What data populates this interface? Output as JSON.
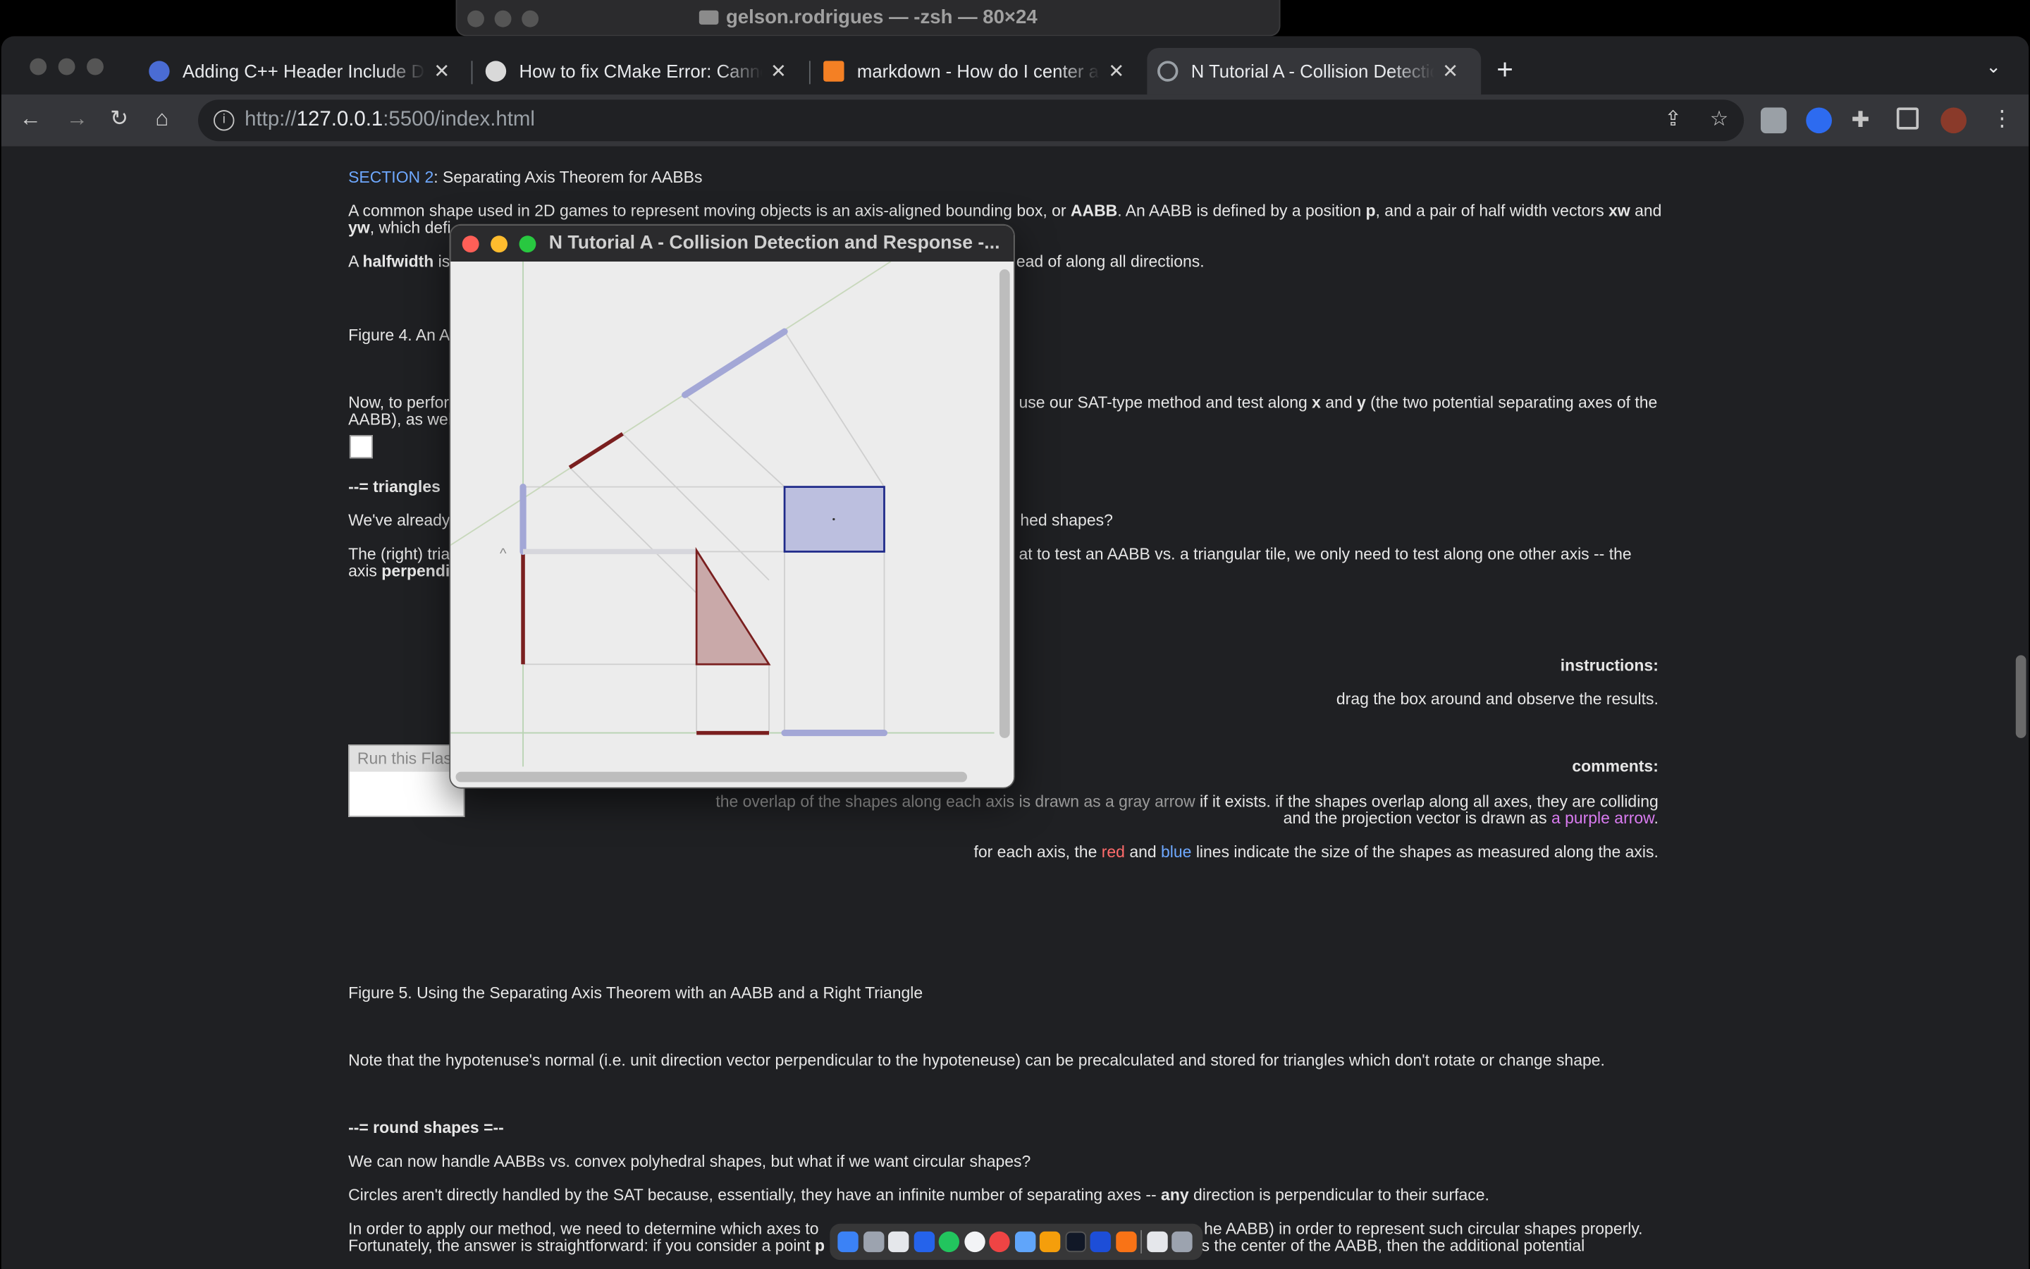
{
  "terminal": {
    "title": "gelson.rodrigues — -zsh — 80×24"
  },
  "tabs": [
    {
      "label": "Adding C++ Header Include Directories",
      "favicon_color": "#4a6cd4"
    },
    {
      "label": "How to fix CMake Error: Cannot find source file",
      "favicon_color": "#d9d9d9"
    },
    {
      "label": "markdown - How do I center an image",
      "favicon_color": "#f48024"
    },
    {
      "label": "N Tutorial A - Collision Detection and Response",
      "favicon_color": "#9aa0a6"
    }
  ],
  "address": {
    "scheme": "http://",
    "host": "127.0.0.1",
    "rest": ":5500/index.html"
  },
  "content": {
    "section_link": "SECTION 2",
    "section_title": ": Separating Axis Theorem for AABBs",
    "p1a": "A common shape used in 2D games to represent moving objects is an axis-aligned bounding box, or ",
    "p1b": "AABB",
    "p1c": ". An AABB is defined by a position ",
    "p1d": "p",
    "p1e": ", and a pair of half width vectors ",
    "p1f": "xw",
    "p1g": " and",
    "p1h": "yw",
    "p1i": ", which defi",
    "p2a": "A ",
    "p2b": "halfwidth",
    "p2c": " is",
    "p2d": "ead of along all directions.",
    "fig4": "Figure 4. An A",
    "p3a": "Now, to perfor",
    "p3b": "use our SAT-type method and test along ",
    "p3c": "x",
    "p3d": " and ",
    "p3e": "y",
    "p3f": " (the two potential separating axes of the",
    "p3g": "AABB), as well",
    "tri_head": "--= triangles",
    "p4a": "We've already",
    "p4b": "hed shapes?",
    "p5a": "The (right) tria",
    "p5b": "at to test an AABB vs. a triangular tile, we only need to test along one other axis -- the",
    "p5c": "axis ",
    "p5d": "perpendi",
    "flash": "Run this Flash",
    "instructions_head": "instructions:",
    "instructions": "drag the box around and observe the results.",
    "comments_head": "comments:",
    "c1a": "the overlap of the shapes along each axis is drawn as a gray arrow",
    "c1b": " if it exists. if the shapes overlap along all axes, they are colliding",
    "c1c": "and the projection vector is drawn as ",
    "c1d": "a purple arrow",
    "c1e": ".",
    "c2a": "for each axis, the ",
    "c2b": "red",
    "c2c": " and ",
    "c2d": "blue",
    "c2e": " lines indicate the size of the shapes as measured along the axis.",
    "fig5": "Figure 5. Using the Separating Axis Theorem with an AABB and a Right Triangle",
    "p6": "Note that the hypotenuse's normal (i.e. unit direction vector perpendicular to the hypoteneuse) can be precalculated and stored for triangles which don't rotate or change shape.",
    "round_head": "--= round shapes =--",
    "p7": "We can now handle AABBs vs. convex polyhedral shapes, but what if we want circular shapes?",
    "p8a": "Circles aren't directly handled by the SAT because, essentially, they have an infinite number of separating axes -- ",
    "p8b": "any",
    "p8c": " direction is perpendicular to their surface.",
    "p9a": "In order to apply our method, we need to determine which axes to",
    "p9b": "he AABB) in order to represent such circular shapes properly.",
    "p10a": "Fortunately, the answer is straightforward: if you consider a point ",
    "p10b": "p",
    "p10c": "s the center of the AABB, then the additional potential"
  },
  "popup": {
    "title": "N Tutorial A - Collision Detection and Response -..."
  },
  "colors": {
    "accent_link": "#6ea8ff",
    "red": "#7a1f1f",
    "blue": "#2a2f8f"
  }
}
